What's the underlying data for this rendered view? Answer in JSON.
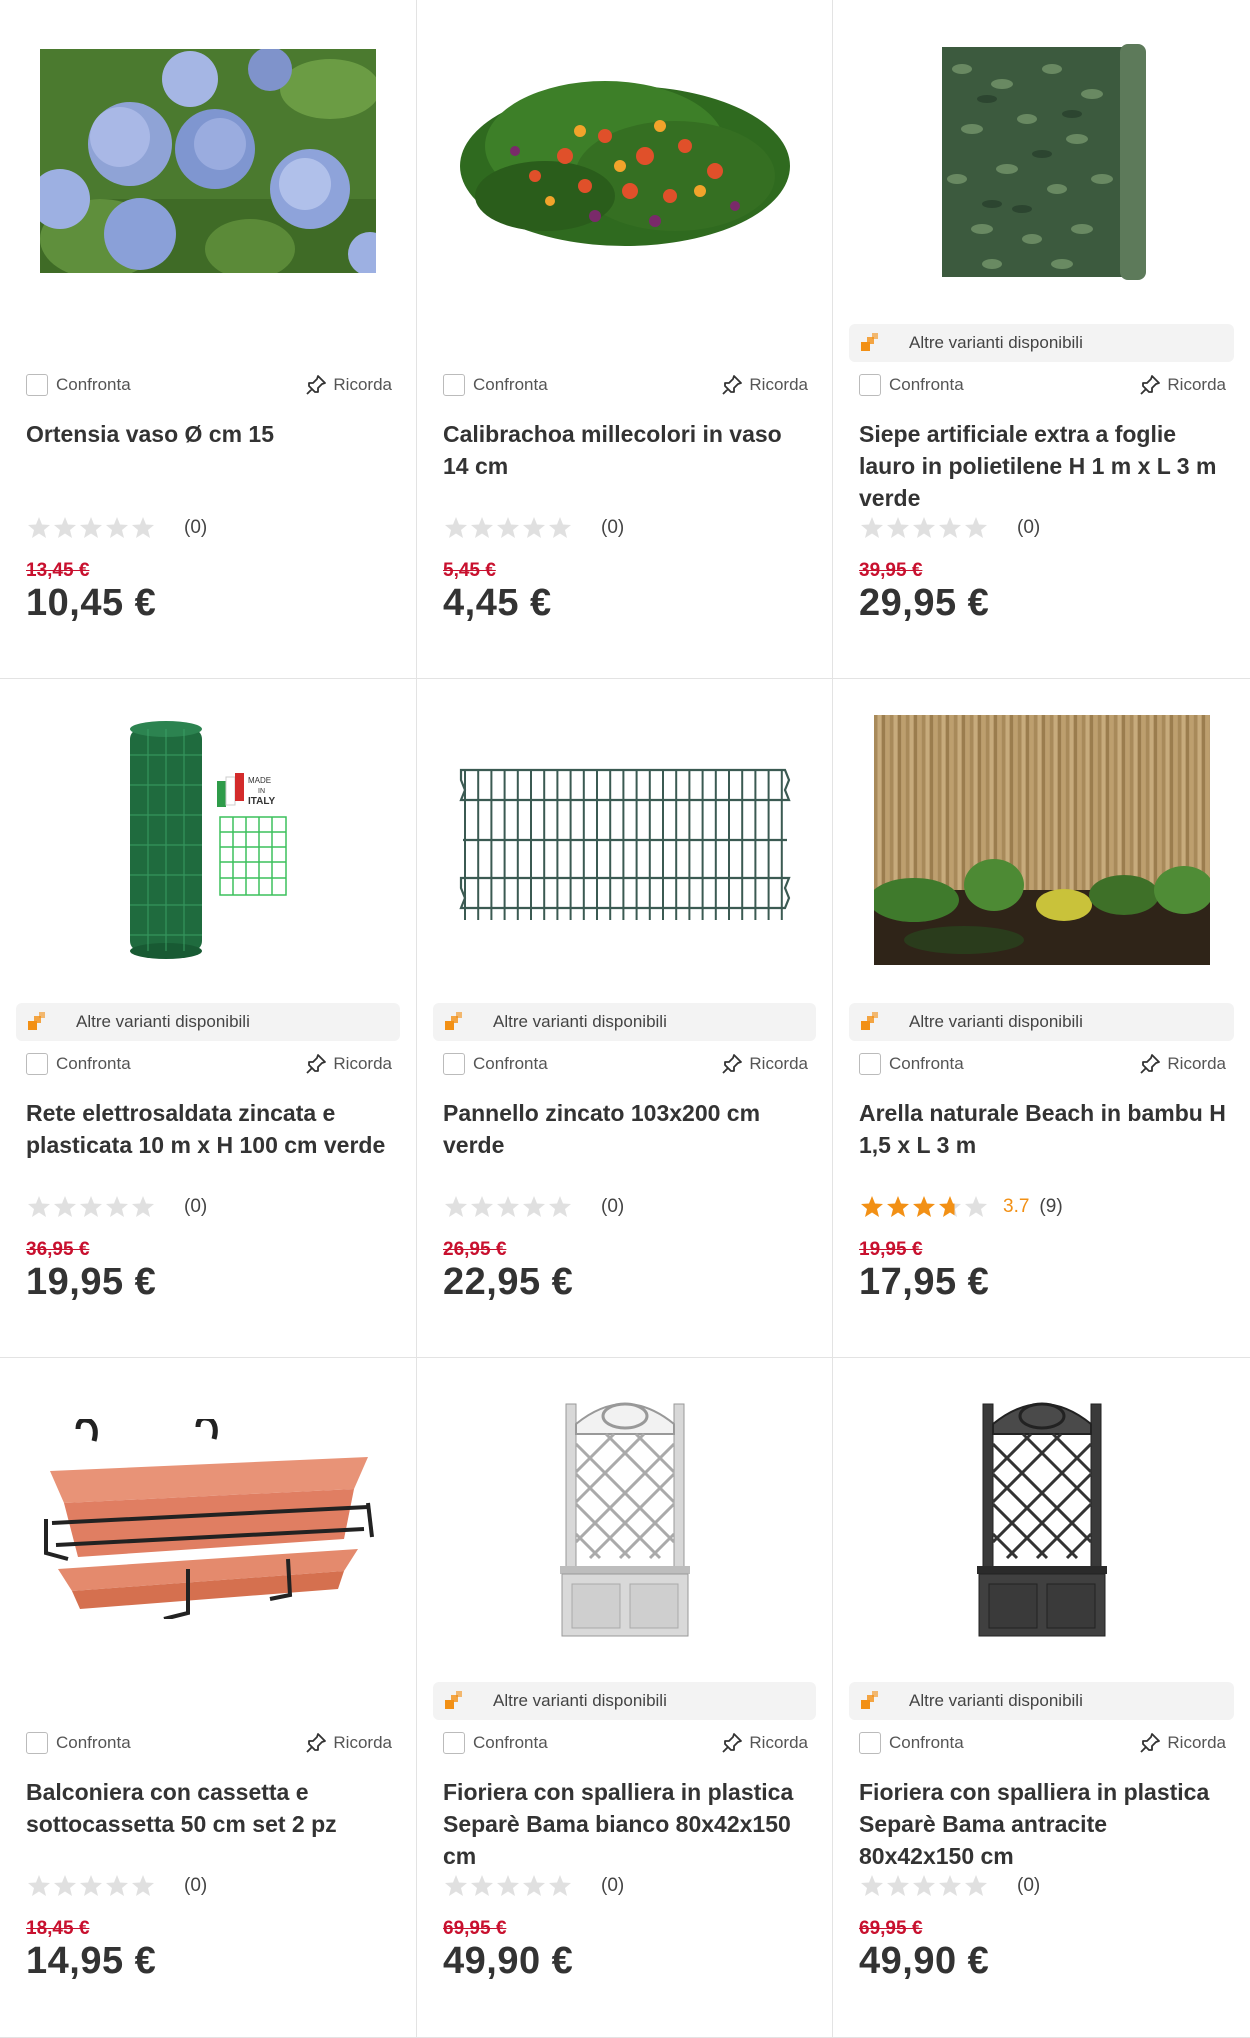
{
  "labels": {
    "compare": "Confronta",
    "remember": "Ricorda",
    "variants": "Altre varianti disponibili"
  },
  "colors": {
    "accent": "#f29015",
    "old_price": "#c8102e",
    "star_empty": "#e0e0e0"
  },
  "products": [
    {
      "title": "Ortensia vaso Ø cm 15",
      "image": "hydrangea-photo",
      "variants": false,
      "rating": 0,
      "score": "",
      "reviews": "(0)",
      "old_price": "13,45 €",
      "price": "10,45 €"
    },
    {
      "title": "Calibrachoa millecolori in vaso 14 cm",
      "image": "calibrachoa-photo",
      "variants": false,
      "rating": 0,
      "score": "",
      "reviews": "(0)",
      "old_price": "5,45 €",
      "price": "4,45 €"
    },
    {
      "title": "Siepe artificiale extra a foglie lauro in polietilene H 1 m x L 3 m verde",
      "image": "artificial-hedge-photo",
      "variants": true,
      "rating": 0,
      "score": "",
      "reviews": "(0)",
      "old_price": "39,95 €",
      "price": "29,95 €"
    },
    {
      "title": "Rete elettrosaldata zincata e plasticata 10 m x H 100 cm verde",
      "image": "welded-mesh-roll-photo",
      "variants": true,
      "rating": 0,
      "score": "",
      "reviews": "(0)",
      "old_price": "36,95 €",
      "price": "19,95 €"
    },
    {
      "title": "Pannello zincato 103x200 cm verde",
      "image": "zinc-panel-photo",
      "variants": true,
      "rating": 0,
      "score": "",
      "reviews": "(0)",
      "old_price": "26,95 €",
      "price": "22,95 €"
    },
    {
      "title": "Arella naturale Beach in bambu H 1,5 x L 3 m",
      "image": "bamboo-fence-photo",
      "variants": true,
      "rating": 3.7,
      "score": "3.7",
      "reviews": "(9)",
      "old_price": "19,95 €",
      "price": "17,95 €"
    },
    {
      "title": "Balconiera con cassetta e sottocassetta 50 cm set 2 pz",
      "image": "balcony-planter-photo",
      "variants": false,
      "rating": 0,
      "score": "",
      "reviews": "(0)",
      "old_price": "18,45 €",
      "price": "14,95 €"
    },
    {
      "title": "Fioriera con spalliera in plastica Separè Bama bianco 80x42x150 cm",
      "image": "white-trellis-planter-photo",
      "variants": true,
      "rating": 0,
      "score": "",
      "reviews": "(0)",
      "old_price": "69,95 €",
      "price": "49,90 €"
    },
    {
      "title": "Fioriera con spalliera in plastica Separè Bama antracite 80x42x150 cm",
      "image": "anthracite-trellis-planter-photo",
      "variants": true,
      "rating": 0,
      "score": "",
      "reviews": "(0)",
      "old_price": "69,95 €",
      "price": "49,90 €"
    }
  ]
}
